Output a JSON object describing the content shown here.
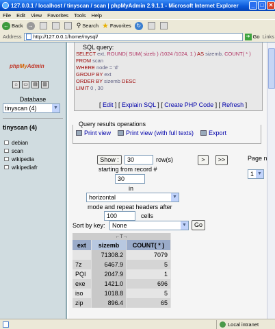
{
  "window": {
    "title": "127.0.0.1 / localhost / tinyscan / scan | phpMyAdmin 2.9.1.1 - Microsoft Internet Explorer",
    "buttons": [
      "_",
      "□",
      "✕"
    ]
  },
  "menu": [
    "File",
    "Edit",
    "View",
    "Favorites",
    "Tools",
    "Help"
  ],
  "toolbar": {
    "back": "Back",
    "search": "Search",
    "favorites": "Favorites"
  },
  "address": {
    "label": "Address",
    "url": "http://127.0.0.1/home/mysql/",
    "go": "Go",
    "links": "Links"
  },
  "left": {
    "logo_php": "php",
    "logo_my": "My",
    "logo_admin": "Admin",
    "database_label": "Database",
    "database_selected": "tinyscan (4)",
    "db_title": "tinyscan (4)",
    "tables": [
      "debian",
      "scan",
      "wikipedia",
      "wikipediafr"
    ]
  },
  "sql": {
    "legend": "SQL query:",
    "lines": [
      {
        "kw": "SELECT",
        "rest": " ext, ",
        "fn": "ROUND( SUM( sizeb ) /1024 /1024, 1 )",
        "kw2": " AS ",
        "rest2": "sizemb, ",
        "fn2": "COUNT( * )"
      },
      {
        "kw": "FROM",
        "rest": " scan"
      },
      {
        "kw": "WHERE",
        "rest": " node = 'd'"
      },
      {
        "kw": "GROUP BY",
        "rest": " ext"
      },
      {
        "kw": "ORDER BY",
        "rest": " sizemb ",
        "kw2": "DESC"
      },
      {
        "kw": "LIMIT",
        "rest": " 0 , 30"
      }
    ],
    "links": [
      "Edit",
      "Explain SQL",
      "Create PHP Code",
      "Refresh"
    ]
  },
  "operations": {
    "legend": "Query results operations",
    "links": [
      "Print view",
      "Print view (with full texts)",
      "Export"
    ]
  },
  "nav": {
    "show_button": "Show :",
    "rows_value": "30",
    "rows_label": "row(s)",
    "start_label": "starting from record #",
    "start_value": "30",
    "in_label": "in",
    "mode_value": "horizontal",
    "mode_label": "mode and repeat headers after",
    "cells_value": "100",
    "cells_label": "cells",
    "next_button": ">",
    "last_button": ">>",
    "page_label": "Page number",
    "page_value": "1"
  },
  "sort": {
    "label": "Sort by key:",
    "value": "None",
    "go": "Go"
  },
  "results": {
    "toggle": "←T→",
    "columns": [
      "ext",
      "sizemb",
      "COUNT( * )"
    ],
    "rows": [
      [
        "",
        "71308.2",
        "7079"
      ],
      [
        "7z",
        "6467.9",
        "5"
      ],
      [
        "PQI",
        "2047.9",
        "1"
      ],
      [
        "exe",
        "1421.0",
        "696"
      ],
      [
        "iso",
        "1018.8",
        "5"
      ],
      [
        "zip",
        "896.4",
        "65"
      ]
    ]
  },
  "status": {
    "zone": "Local intranet"
  }
}
